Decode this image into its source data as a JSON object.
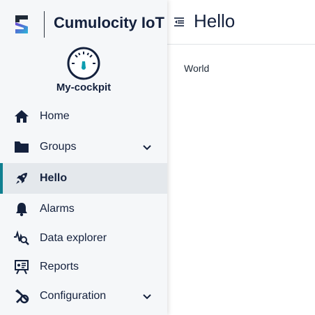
{
  "brand": {
    "title": "Cumulocity IoT",
    "logo_icon": "cumulocity-logo"
  },
  "app": {
    "name": "My-cockpit",
    "icon": "speedometer-icon",
    "accent": "#0f7f90"
  },
  "nav": {
    "items": [
      {
        "label": "Home",
        "icon": "home-icon"
      },
      {
        "label": "Groups",
        "icon": "folder-icon",
        "expandable": true
      },
      {
        "label": "Hello",
        "icon": "rocket-icon",
        "active": true
      },
      {
        "label": "Alarms",
        "icon": "bell-icon"
      },
      {
        "label": "Data explorer",
        "icon": "data-explorer-icon"
      },
      {
        "label": "Reports",
        "icon": "reports-icon"
      },
      {
        "label": "Configuration",
        "icon": "configuration-icon",
        "expandable": true
      }
    ]
  },
  "header": {
    "title": "Hello",
    "toggle_icon": "menu-toggle-icon"
  },
  "content": {
    "text": "World"
  }
}
